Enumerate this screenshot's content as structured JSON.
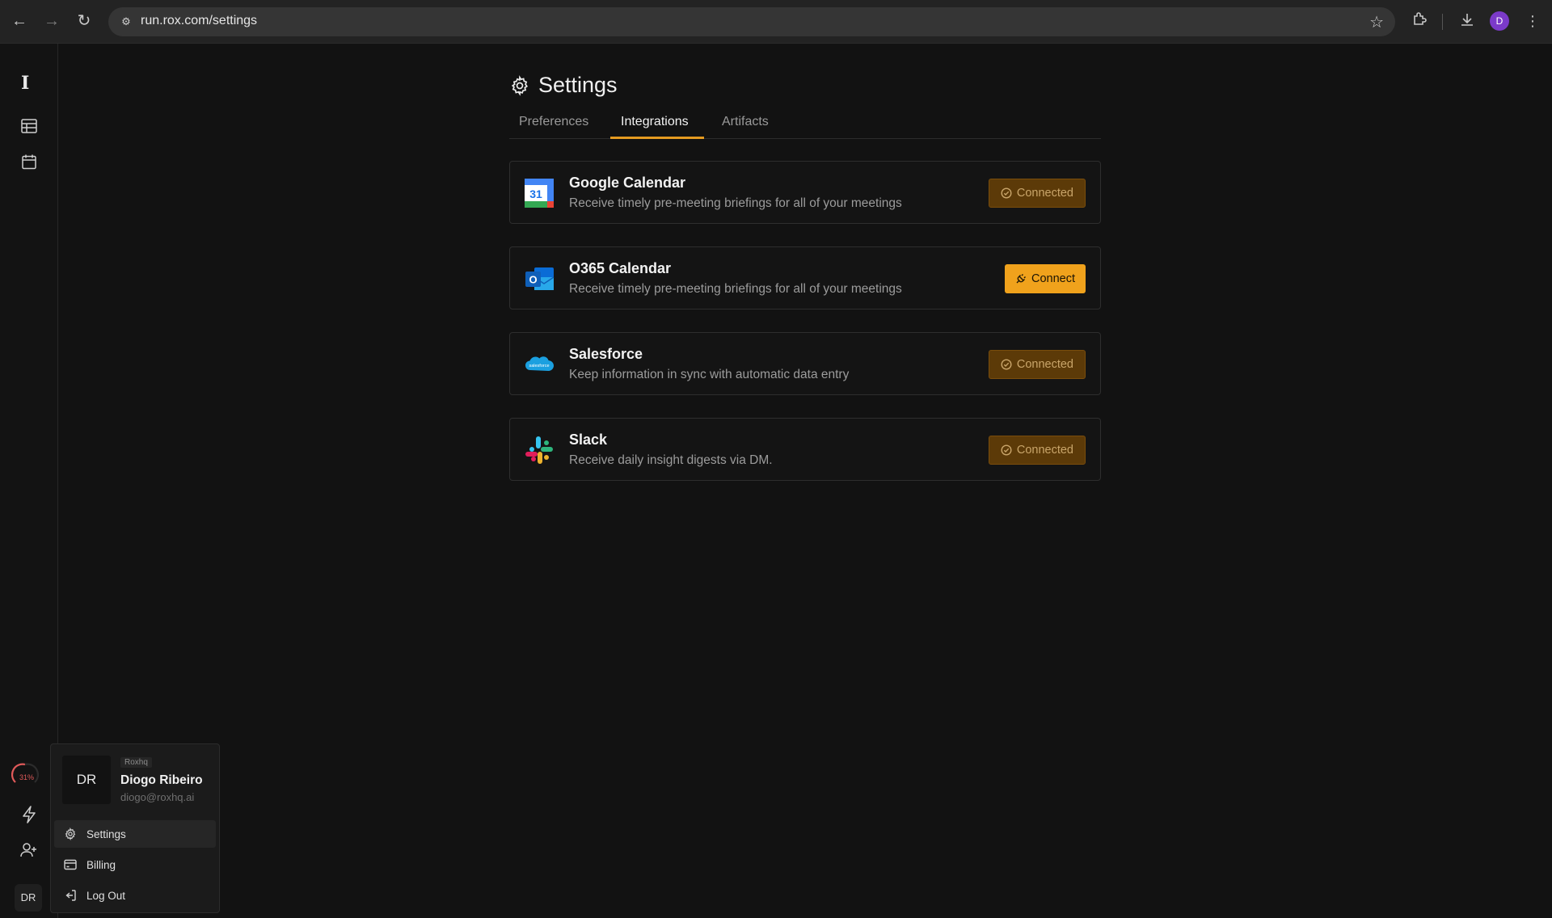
{
  "browser": {
    "url": "run.rox.com/settings",
    "profile_initial": "D"
  },
  "sidebar": {
    "usage_percent": "31%",
    "avatar_initials": "DR"
  },
  "page": {
    "title": "Settings",
    "tabs": [
      {
        "label": "Preferences",
        "active": false
      },
      {
        "label": "Integrations",
        "active": true
      },
      {
        "label": "Artifacts",
        "active": false
      }
    ]
  },
  "integrations": [
    {
      "name": "Google Calendar",
      "description": "Receive timely pre-meeting briefings for all of your meetings",
      "status": "Connected",
      "icon": "google-calendar-icon"
    },
    {
      "name": "O365 Calendar",
      "description": "Receive timely pre-meeting briefings for all of your meetings",
      "status": "Connect",
      "icon": "outlook-icon"
    },
    {
      "name": "Salesforce",
      "description": "Keep information in sync with automatic data entry",
      "status": "Connected",
      "icon": "salesforce-icon"
    },
    {
      "name": "Slack",
      "description": "Receive daily insight digests via DM.",
      "status": "Connected",
      "icon": "slack-icon"
    }
  ],
  "user_menu": {
    "initials": "DR",
    "org": "Roxhq",
    "name": "Diogo Ribeiro",
    "email": "diogo@roxhq.ai",
    "items": [
      {
        "label": "Settings",
        "icon": "gear-icon"
      },
      {
        "label": "Billing",
        "icon": "credit-card-icon"
      },
      {
        "label": "Log Out",
        "icon": "log-out-icon"
      }
    ]
  },
  "colors": {
    "accent": "#f0a21c",
    "connected_bg": "#5c3a08",
    "background": "#121212"
  }
}
